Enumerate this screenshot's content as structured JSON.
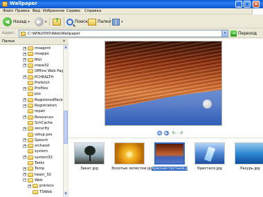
{
  "window": {
    "title": "Wallpaper",
    "controls": {
      "minimize": "_",
      "maximize": "□",
      "close": "×"
    }
  },
  "menu": [
    "Файл",
    "Правка",
    "Вид",
    "Избранное",
    "Сервис",
    "Справка"
  ],
  "toolbar": {
    "back_label": "Назад",
    "back_arrow": "◀",
    "forward_arrow": "▶",
    "dropdown": "▾",
    "search_label": "Поиск",
    "folders_label": "Папки"
  },
  "address": {
    "label": "Адрес",
    "value": "C:\\WIN2000\\Web\\Wallpaper",
    "go_label": "Переход",
    "dropdown": "▾"
  },
  "tree": {
    "title": "Папки",
    "close": "×",
    "items": [
      {
        "label": "msagent",
        "expander": "+",
        "open": false
      },
      {
        "label": "msapps",
        "expander": "+",
        "open": false
      },
      {
        "label": "MUI",
        "expander": "+",
        "open": false
      },
      {
        "label": "mww32",
        "expander": "+",
        "open": false
      },
      {
        "label": "Offline Web Pages",
        "expander": "",
        "open": false
      },
      {
        "label": "PCHEALTH",
        "expander": "+",
        "open": false
      },
      {
        "label": "Prefetch",
        "expander": "",
        "open": false
      },
      {
        "label": "Profiles",
        "expander": "+",
        "open": false
      },
      {
        "label": "pss",
        "expander": "",
        "open": false
      },
      {
        "label": "RegisteredPackages",
        "expander": "+",
        "open": false
      },
      {
        "label": "Registration",
        "expander": "+",
        "open": false
      },
      {
        "label": "repair",
        "expander": "",
        "open": false
      },
      {
        "label": "Resources",
        "expander": "+",
        "open": false
      },
      {
        "label": "SchCache",
        "expander": "",
        "open": false
      },
      {
        "label": "security",
        "expander": "+",
        "open": false
      },
      {
        "label": "setup.pss",
        "expander": "",
        "open": false
      },
      {
        "label": "Speech",
        "expander": "+",
        "open": false
      },
      {
        "label": "srchasst",
        "expander": "+",
        "open": false
      },
      {
        "label": "system",
        "expander": "",
        "open": false
      },
      {
        "label": "system32",
        "expander": "+",
        "open": false
      },
      {
        "label": "Tasks",
        "expander": "",
        "open": false
      },
      {
        "label": "Temp",
        "expander": "+",
        "open": false
      },
      {
        "label": "twain_32",
        "expander": "+",
        "open": false
      },
      {
        "label": "Web",
        "expander": "−",
        "open": true
      },
      {
        "label": "printers",
        "expander": "+",
        "open": false
      },
      {
        "label": "TSWeb",
        "expander": "",
        "open": false
      }
    ]
  },
  "nav_controls": {
    "prev": "◀",
    "next": "▶",
    "rotate_cw": "↻",
    "rotate_ccw": "↺"
  },
  "thumbnails": [
    {
      "caption": "Закат.jpg",
      "selected": false
    },
    {
      "caption": "Золотые лепестки.jpg",
      "selected": false
    },
    {
      "caption": "Красная пустыня.jpg",
      "selected": true
    },
    {
      "caption": "Кристалл.jpg",
      "selected": false
    },
    {
      "caption": "Лазурь.jpg",
      "selected": false
    }
  ],
  "colors": {
    "titlebar": "#0a5fd8",
    "chrome": "#ece9d8",
    "selection": "#316ac5"
  }
}
